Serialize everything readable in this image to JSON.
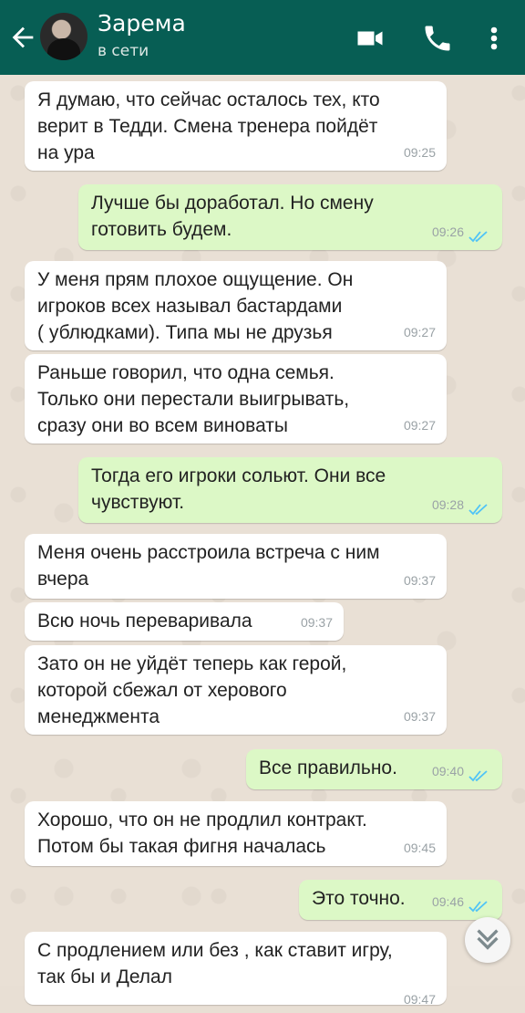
{
  "header": {
    "contact_name": "Зарема",
    "status": "в сети"
  },
  "messages": [
    {
      "dir": "in",
      "text": "Я думаю, что сейчас осталось тех, кто\nверит в Тедди. Смена тренера пойдёт\nна ура",
      "time": "09:25"
    },
    {
      "dir": "out",
      "text": "Лучше бы доработал. Но смену\nготовить будем.",
      "time": "09:26"
    },
    {
      "dir": "in",
      "text": "У меня прям плохое ощущение. Он\nигроков всех называл бастардами\n( ублюдками). Типа мы не друзья",
      "time": "09:27"
    },
    {
      "dir": "in",
      "text": "Раньше говорил, что одна семья.\nТолько они перестали выигрывать,\nсразу они во всем виноваты",
      "time": "09:27"
    },
    {
      "dir": "out",
      "text": "Тогда его игроки сольют. Они все\nчувствуют.",
      "time": "09:28"
    },
    {
      "dir": "in",
      "text": "Меня очень расстроила встреча с ним\nвчера",
      "time": "09:37"
    },
    {
      "dir": "in",
      "text": "Всю ночь переваривала",
      "time": "09:37"
    },
    {
      "dir": "in",
      "text": "Зато он не уйдёт теперь как герой,\nкоторой сбежал от херового\nменеджмента",
      "time": "09:37"
    },
    {
      "dir": "out",
      "text": "Все правильно.",
      "time": "09:40"
    },
    {
      "dir": "in",
      "text": "Хорошо, что он не продлил контракт.\nПотом бы такая фигня началась",
      "time": "09:45"
    },
    {
      "dir": "out",
      "text": "Это точно.",
      "time": "09:46"
    },
    {
      "dir": "in",
      "text": "С продлением или без , как ставит игру,\nтак бы и Делал",
      "time": "09:47"
    }
  ],
  "colors": {
    "header": "#075e54",
    "incoming_bubble": "#ffffff",
    "outgoing_bubble": "#dcf8c6",
    "read_ticks": "#4fc3f7"
  },
  "icons": [
    "back-arrow-icon",
    "video-call-icon",
    "phone-icon",
    "more-options-icon",
    "double-check-icon",
    "scroll-down-icon"
  ]
}
